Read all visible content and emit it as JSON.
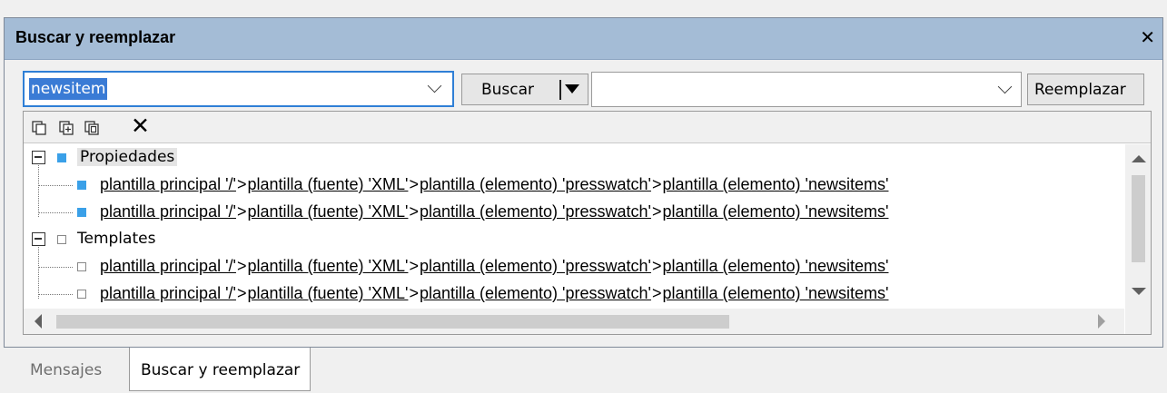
{
  "window": {
    "title": "Buscar y reemplazar",
    "close_glyph": "✕"
  },
  "search": {
    "value": "newsitem",
    "find_button": "Buscar",
    "replace_value": "",
    "replace_button": "Reemplazar"
  },
  "toolbar": {
    "icons": [
      "copy-icon",
      "copy-expand-icon",
      "copy-all-icon",
      "clear-icon"
    ],
    "clear_glyph": "✕"
  },
  "results": {
    "groups": [
      {
        "label": "Propiedades",
        "marker": "blue",
        "items": [
          [
            "plantilla principal '/'",
            "plantilla (fuente) 'XML'",
            "plantilla (elemento) 'presswatch'",
            "plantilla (elemento) 'newsitems'"
          ],
          [
            "plantilla principal '/'",
            "plantilla (fuente) 'XML'",
            "plantilla (elemento) 'presswatch'",
            "plantilla (elemento) 'newsitems'"
          ]
        ]
      },
      {
        "label": "Templates",
        "marker": "empty",
        "items": [
          [
            "plantilla principal '/'",
            "plantilla (fuente) 'XML'",
            "plantilla (elemento) 'presswatch'",
            "plantilla (elemento) 'newsitems'"
          ],
          [
            "plantilla principal '/'",
            "plantilla (fuente) 'XML'",
            "plantilla (elemento) 'presswatch'",
            "plantilla (elemento) 'newsitems'"
          ]
        ]
      }
    ],
    "separator": ">"
  },
  "tabs": [
    {
      "label": "Mensajes",
      "active": false
    },
    {
      "label": "Buscar y reemplazar",
      "active": true
    }
  ],
  "colors": {
    "titlebar": "#a4bcd6",
    "selection": "#3a7bd5",
    "marker_blue": "#3aa0e8"
  }
}
